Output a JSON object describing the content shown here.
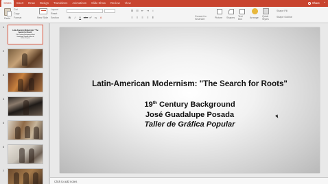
{
  "ribbon_tabs": [
    "Home",
    "Insert",
    "Draw",
    "Design",
    "Transitions",
    "Animations",
    "Slide Show",
    "Review",
    "View"
  ],
  "active_tab": "Home",
  "share_label": "Share",
  "ribbon": {
    "paste": "Paste",
    "cut": "Cut",
    "copy": "Copy",
    "format": "Format",
    "new_slide": "New Slide",
    "layout": "Layout",
    "reset": "Reset",
    "section": "Section",
    "convert_to_smartart": "Convert to SmartArt",
    "picture": "Picture",
    "shapes": "Shapes",
    "text_box": "Text Box",
    "arrange": "Arrange",
    "quick_styles": "Quick Styles",
    "shape_fill": "Shape Fill",
    "shape_outline": "Shape Outline",
    "format_buttons": [
      "B",
      "I",
      "U",
      "abc",
      "x²",
      "x₂",
      "A"
    ]
  },
  "thumbnails": [
    {
      "number": "1",
      "title": "Latin-American Modernism: \"The Search for Roots\"",
      "subtitle": "19th Century Background José Guadalupe Posada Taller de Gráfica Popular",
      "selected": true
    },
    {
      "number": "2"
    },
    {
      "number": "3"
    },
    {
      "number": "4"
    },
    {
      "number": "5"
    },
    {
      "number": "6"
    },
    {
      "number": "7"
    }
  ],
  "slide": {
    "title": "Latin-American Modernism: \"The Search for Roots\"",
    "line1_num": "19",
    "line1_sup": "th",
    "line1_rest": " Century Background",
    "line2": "José Guadalupe Posada",
    "line3": "Taller de Gráfica Popular"
  },
  "notes_placeholder": "Click to add notes"
}
